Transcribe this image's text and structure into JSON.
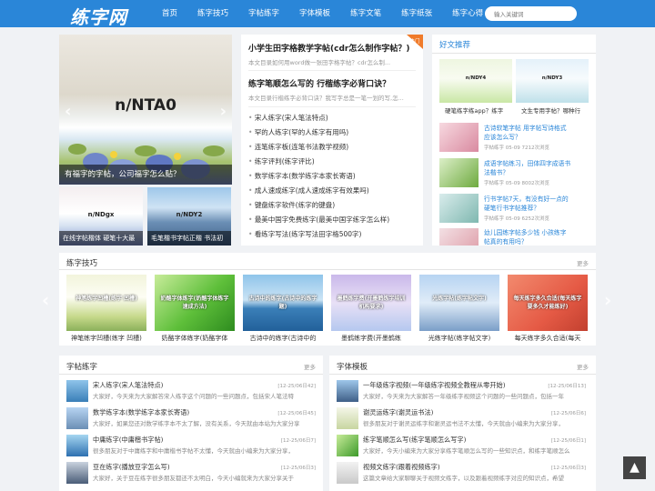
{
  "header": {
    "logo": "练字网",
    "nav": [
      "首页",
      "练字技巧",
      "字帖练字",
      "字体模板",
      "练字文笔",
      "练字纸张",
      "练字心得"
    ],
    "search_placeholder": "输入关键词"
  },
  "slider": {
    "main_code": "n/NTA0",
    "main_caption": "有福字的字帖，公司福字怎么贴？",
    "thumbs": [
      {
        "code": "n/NDgx",
        "caption": "在线字帖楷体 硬笔十大最"
      },
      {
        "code": "n/NDY2",
        "caption": "毛笔楷书字帖正楷 书法初"
      }
    ]
  },
  "center": {
    "hot_badge": "热门",
    "news": [
      {
        "title": "小学生田字格教学字帖(cdr怎么制作字帖？)",
        "desc": "本文目录如何用word做一张田字格字帖？cdr怎么制..."
      },
      {
        "title": "练字笔顺怎么写的 行楷练字必背口诀？",
        "desc": "本文目录行楷练字必背口诀？我写字总是一笔一划的写,怎..."
      }
    ],
    "list": [
      "宋人练字(宋人笔法特点)",
      "罕的人练字(罕的人练字有用吗)",
      "连笔练字板(连笔书法教学视频)",
      "练字评判(练字评比)",
      "数学练字本(数学练字本家长寄语)",
      "成人速成练字(成人速成练字有效果吗)",
      "键盘练字软件(练字的键盘)",
      "最美中国字免费练字(最美中国字练字怎么样)",
      "看练字写法(练字写法田字格500字)"
    ]
  },
  "recommend": {
    "title": "好文推荐",
    "top": [
      {
        "code": "n/NDY4",
        "caption": "硬笔练字练app？练字"
      },
      {
        "code": "n/NDY3",
        "caption": "文生专用字帖？哪种行"
      }
    ],
    "items": [
      {
        "title": "古诗软笔字帖 用字帖写诗格式应该怎么写？",
        "meta": "字帖练字   05-09   7212次浏览"
      },
      {
        "title": "成语字帖练习，田体四字成语书法楷书？",
        "meta": "字帖练字   05-09   8002次浏览"
      },
      {
        "title": "行书字帖7天，有没有好一点的硬笔行书字帖推荐？",
        "meta": "字帖练字   05-09   6252次浏览"
      },
      {
        "title": "幼儿园练字帖多少钱 小孩练字帖真的有用吗？",
        "meta": ""
      }
    ]
  },
  "techniques": {
    "title": "练字技巧",
    "more": "更多",
    "cards": [
      {
        "overlay": "神笔练字凹槽(练字 凹槽)",
        "caption": "神笔练字凹槽(练字 凹槽)"
      },
      {
        "overlay": "奶酪字体练字(奶酪字体练字速成方法)",
        "caption": "奶酪字体练字(奶酪字体"
      },
      {
        "overlay": "古诗中的练字(古诗中的练字题)",
        "caption": "古诗中的练字(古诗中的"
      },
      {
        "overlay": "墨鹤练字费(开墨鹤练字培训机构要求)",
        "caption": "墨鹤练字费(开墨鹤练"
      },
      {
        "overlay": "光练字帖(练字帖文字)",
        "caption": "光练字帖(练字帖文字)"
      },
      {
        "overlay": "每天练字多久合适(每天练字要多久才能练好)",
        "caption": "每天练字多久合适(每天"
      }
    ]
  },
  "copybook": {
    "title": "字帖练字",
    "more": "更多",
    "items": [
      {
        "title": "宋人练字(宋人笔法特点)",
        "date": "[12-25/06日42]",
        "desc": "大家好，今天来为大家解答宋人练字这个问题的一些问题点，包括宋人笔法特"
      },
      {
        "title": "数学练字本(数学练字本家长寄语)",
        "date": "[12-25/06日45]",
        "desc": "大家好，如果您还对数学练字本不太了解，没有关系，今天就由本站为大家分享"
      },
      {
        "title": "中庸练字(中庸楷书字帖)",
        "date": "[12-25/06日7]",
        "desc": "很多朋友对于中庸练字和中庸楷书字帖不太懂，今天就由小编来为大家分享，"
      },
      {
        "title": "豆在练字(播放豆字怎么写)",
        "date": "[12-25/06日3]",
        "desc": "大家好，关于豆在练字很多朋友都还不太明白，今天小编就来为大家分享关于"
      }
    ]
  },
  "templates": {
    "title": "字体模板",
    "more": "更多",
    "items": [
      {
        "title": "一年级练字视频(一年级练字视频全教程从零开始)",
        "date": "[12-25/06日13]",
        "desc": "大家好，今天来为大家解答一年级练字视频这个问题的一些问题点，包括一年"
      },
      {
        "title": "谢灵运练字(谢灵运书法)",
        "date": "[12-25/06日6]",
        "desc": "很多朋友对于谢灵运练字和谢灵运书法不太懂，今天就由小编来为大家分享，"
      },
      {
        "title": "练字笔顺怎么写(练字笔顺怎么写字)",
        "date": "[12-25/06日1]",
        "desc": "大家好，今天小编来为大家分享练字笔顺怎么写的一些知识点，和练字笔顺怎么"
      },
      {
        "title": "视频文练字(跟着视频练字)",
        "date": "[12-25/06日3]",
        "desc": "这篇文章给大家聊聊关于视频文练字，以及跟着视频练字对应的知识点，希望"
      }
    ]
  },
  "back_to_top": "▲"
}
